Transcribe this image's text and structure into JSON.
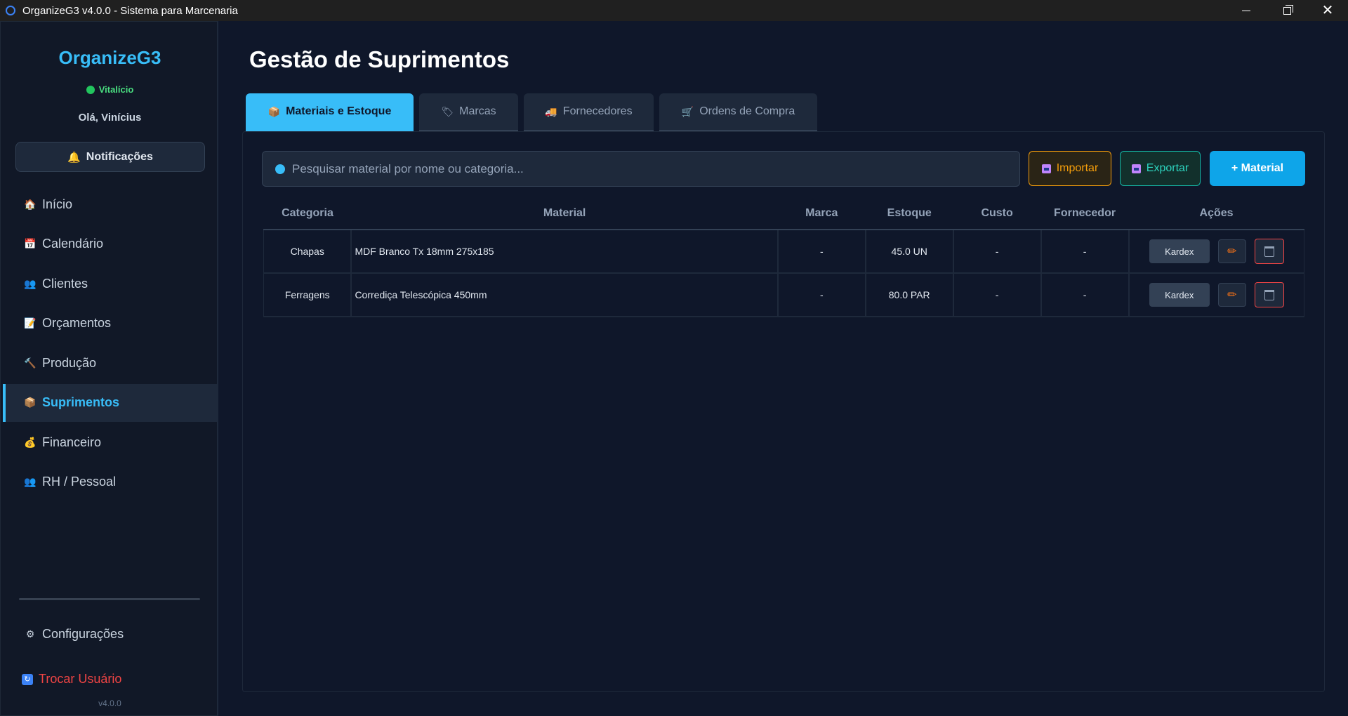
{
  "window": {
    "title": "OrganizeG3 v4.0.0 - Sistema para Marcenaria"
  },
  "sidebar": {
    "brand": "OrganizeG3",
    "plan": "Vitalício",
    "greeting": "Olá, Vinícius",
    "notifications_label": "Notificações",
    "items": [
      {
        "label": "Início",
        "icon": "house-icon"
      },
      {
        "label": "Calendário",
        "icon": "calendar-icon"
      },
      {
        "label": "Clientes",
        "icon": "users-icon"
      },
      {
        "label": "Orçamentos",
        "icon": "document-icon"
      },
      {
        "label": "Produção",
        "icon": "hammer-icon"
      },
      {
        "label": "Suprimentos",
        "icon": "package-icon",
        "active": true
      },
      {
        "label": "Financeiro",
        "icon": "money-bag-icon"
      },
      {
        "label": "RH / Pessoal",
        "icon": "people-icon"
      }
    ],
    "settings_label": "Configurações",
    "switch_user_label": "Trocar Usuário",
    "version": "v4.0.0"
  },
  "main": {
    "title": "Gestão de Suprimentos",
    "tabs": [
      {
        "label": "Materiais e Estoque",
        "active": true
      },
      {
        "label": "Marcas"
      },
      {
        "label": "Fornecedores"
      },
      {
        "label": "Ordens de Compra"
      }
    ],
    "search_placeholder": "Pesquisar material por nome ou categoria...",
    "import_label": "Importar",
    "export_label": "Exportar",
    "add_label": "+ Material"
  },
  "table": {
    "columns": [
      "Categoria",
      "Material",
      "Marca",
      "Estoque",
      "Custo",
      "Fornecedor",
      "Ações"
    ],
    "rows": [
      {
        "categoria": "Chapas",
        "material": "MDF Branco Tx 18mm 275x185",
        "marca": "-",
        "estoque": "45.0 UN",
        "custo": "-",
        "fornecedor": "-",
        "kardex": "Kardex"
      },
      {
        "categoria": "Ferragens",
        "material": "Corrediça Telescópica 450mm",
        "marca": "-",
        "estoque": "80.0 PAR",
        "custo": "-",
        "fornecedor": "-",
        "kardex": "Kardex"
      }
    ]
  },
  "colors": {
    "accent": "#38bdf8",
    "background": "#0f172a",
    "danger": "#ef4444",
    "import": "#f59e0b",
    "export": "#14b8a6"
  }
}
